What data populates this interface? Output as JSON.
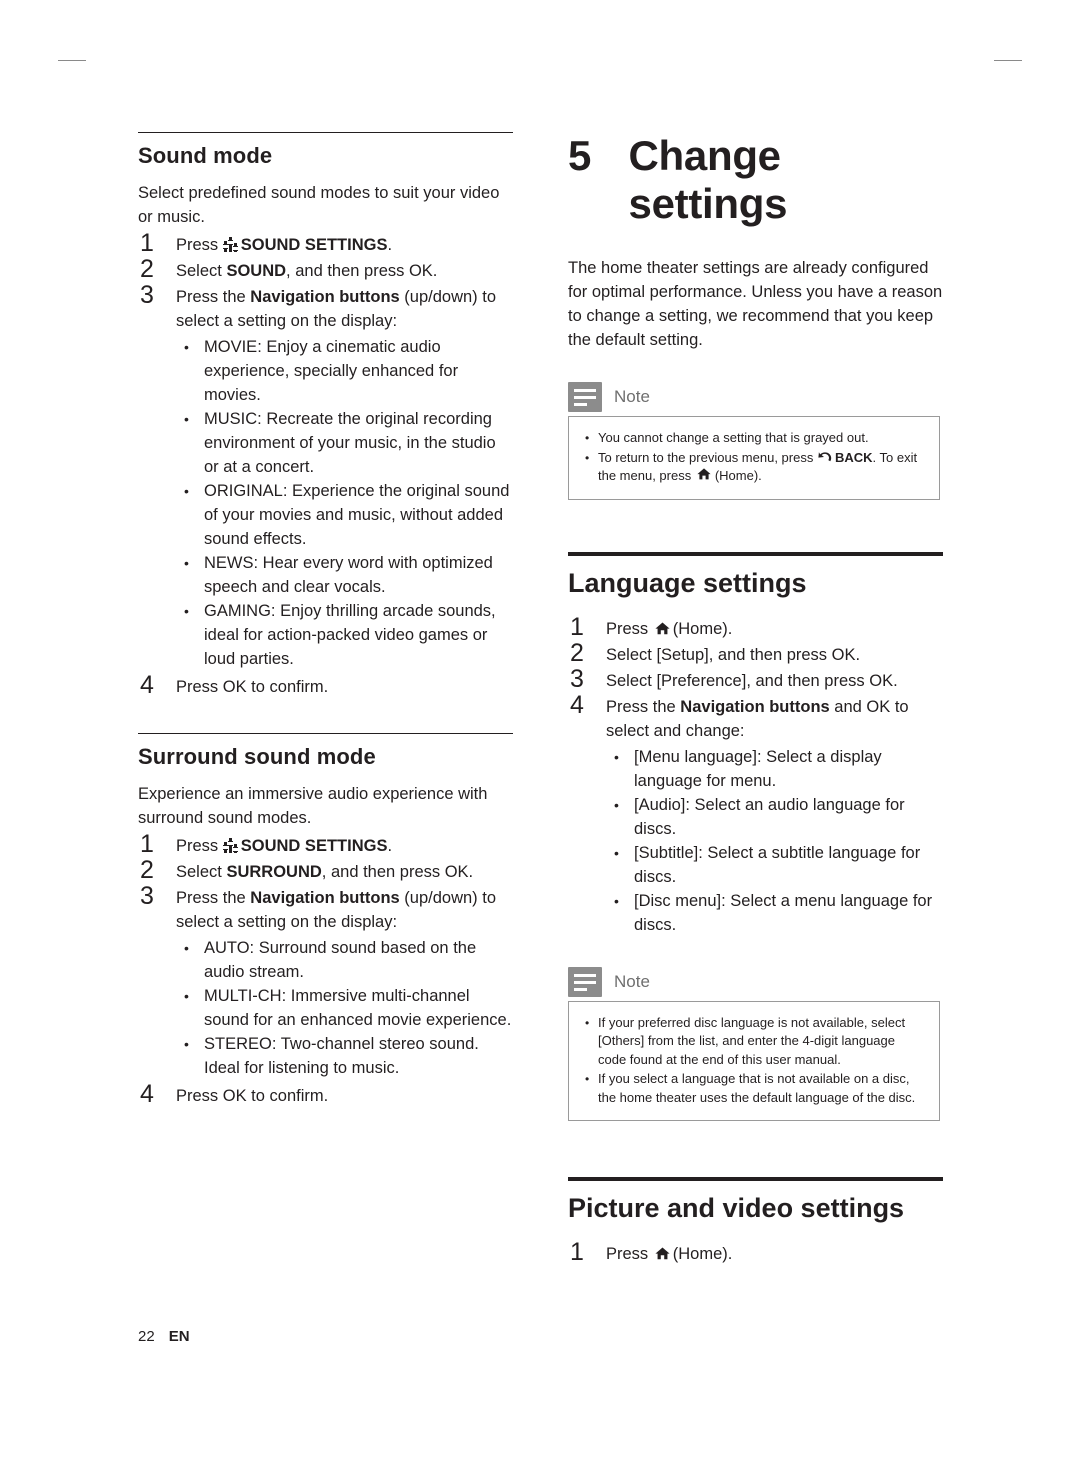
{
  "page": {
    "number": "22",
    "locale": "EN"
  },
  "left_column": {
    "section1": {
      "heading": "Sound mode",
      "intro": "Select predefined sound modes to suit your video or music.",
      "steps": [
        {
          "num": "1",
          "pre": "Press ",
          "icon": "sound-settings-icon",
          "bold": "SOUND SETTINGS",
          "post": "."
        },
        {
          "num": "2",
          "pre": "Select ",
          "bold": "SOUND",
          "post": ", and then press OK."
        },
        {
          "num": "3",
          "pre": "Press the ",
          "bold": "Navigation buttons",
          "post": " (up/down) to select a setting on the display:"
        },
        {
          "num": "4",
          "pre": "Press OK to confirm.",
          "bold": "",
          "post": ""
        }
      ],
      "bullets": [
        {
          "term": "MOVIE",
          "text": ": Enjoy a cinematic audio experience, specially enhanced for movies."
        },
        {
          "term": "MUSIC",
          "text": ": Recreate the original recording environment of your music, in the studio or at a concert."
        },
        {
          "term": "ORIGINAL",
          "text": ": Experience the original sound of your movies and music, without added sound effects."
        },
        {
          "term": "NEWS",
          "text": ": Hear every word with optimized speech and clear vocals."
        },
        {
          "term": "GAMING",
          "text": ": Enjoy thrilling arcade sounds, ideal for action-packed video games or loud parties."
        }
      ]
    },
    "section2": {
      "heading": "Surround sound mode",
      "intro": "Experience an immersive audio experience with surround sound modes.",
      "steps": [
        {
          "num": "1",
          "pre": "Press ",
          "icon": "sound-settings-icon",
          "bold": "SOUND SETTINGS",
          "post": "."
        },
        {
          "num": "2",
          "pre": "Select ",
          "bold": "SURROUND",
          "post": ", and then press OK."
        },
        {
          "num": "3",
          "pre": "Press the ",
          "bold": "Navigation buttons",
          "post": " (up/down) to select a setting on the display:"
        },
        {
          "num": "4",
          "pre": "Press OK to confirm.",
          "bold": "",
          "post": ""
        }
      ],
      "bullets": [
        {
          "term": "AUTO",
          "text": ": Surround sound based on the audio stream."
        },
        {
          "term": "MULTI-CH",
          "text": ": Immersive multi-channel sound for an enhanced movie experience."
        },
        {
          "term": "STEREO",
          "text": ": Two-channel stereo sound. Ideal for listening to music."
        }
      ]
    }
  },
  "right_column": {
    "chapter": {
      "number": "5",
      "title": "Change settings"
    },
    "intro": "The home theater settings are already configured for optimal performance. Unless you have a reason to change a setting, we recommend that you keep the default setting.",
    "note1": {
      "title": "Note",
      "items": [
        {
          "text": "You cannot change a setting that is grayed out."
        },
        {
          "pre": "To return to the previous menu, press ",
          "icon": "back-icon",
          "bold": "BACK",
          "mid": ". To exit the menu, press ",
          "icon2": "home-icon",
          "bold2": "(Home)",
          "post": "."
        }
      ]
    },
    "section_language": {
      "heading": "Language settings",
      "steps": [
        {
          "num": "1",
          "pre": "Press ",
          "icon": "home-icon",
          "post": "(Home)."
        },
        {
          "num": "2",
          "pre": "Select [Setup], and then press OK."
        },
        {
          "num": "3",
          "pre": "Select [Preference], and then press OK."
        },
        {
          "num": "4",
          "pre": "Press the ",
          "bold": "Navigation buttons",
          "post": " and OK to select and change:"
        }
      ],
      "bullets": [
        {
          "term": "[Menu language]",
          "text": ": Select a display language for menu."
        },
        {
          "term": "[Audio]",
          "text": ": Select an audio language for discs."
        },
        {
          "term": "[Subtitle]",
          "text": ": Select a subtitle language for discs."
        },
        {
          "term": "[Disc menu]",
          "text": ": Select a menu language for discs."
        }
      ]
    },
    "note2": {
      "title": "Note",
      "items": [
        {
          "text": "If your preferred disc language is not available, select [Others] from the list, and enter the 4-digit language code found at the end of this user manual."
        },
        {
          "text": "If you select a language that is not available on a disc, the home theater uses the default language of the disc."
        }
      ]
    },
    "section_picture": {
      "heading": "Picture and video settings",
      "steps": [
        {
          "num": "1",
          "pre": "Press ",
          "icon": "home-icon",
          "post": "(Home)."
        }
      ]
    }
  }
}
